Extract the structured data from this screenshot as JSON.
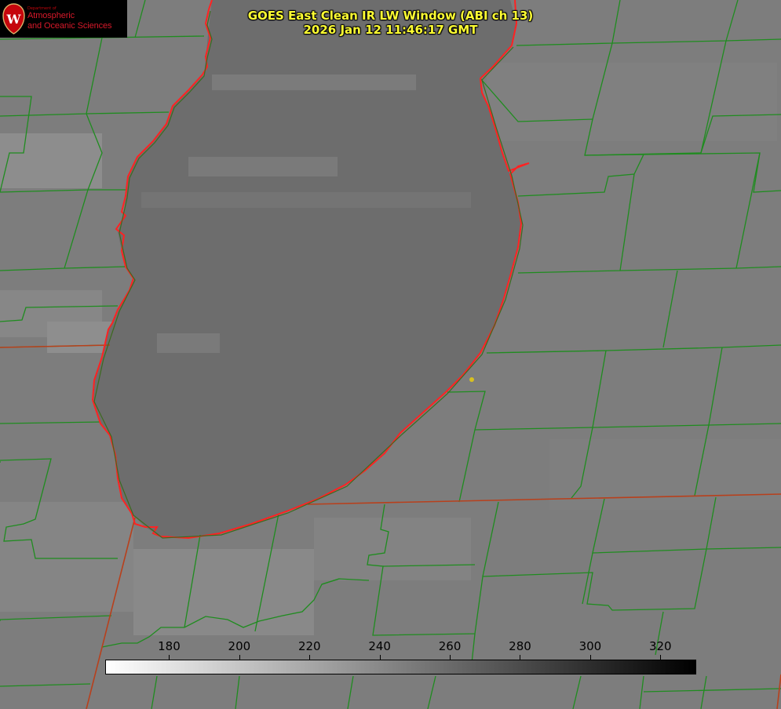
{
  "title": {
    "line1": "GOES East Clean IR LW Window (ABI ch 13)",
    "line2": "2026 Jan 12 11:46:17 GMT"
  },
  "logo": {
    "department": "Department of",
    "line1": "Atmospheric",
    "line2": "and Oceanic Sciences"
  },
  "colorbar": {
    "ticks": [
      "180",
      "200",
      "220",
      "240",
      "260",
      "280",
      "300",
      "320"
    ],
    "tick_values": [
      180,
      200,
      220,
      240,
      260,
      280,
      300,
      320
    ],
    "range": [
      162,
      330
    ],
    "gradient_start": "#ffffff",
    "gradient_end": "#000000"
  },
  "colors": {
    "background": "#7e7e7e",
    "lake": "#6e6e6e",
    "county_lines": "#1e8c1e",
    "state_lines": "#b03a1a",
    "lake_outline": "#ff2020",
    "title_text": "#ffff33",
    "marker": "#d8c020"
  }
}
